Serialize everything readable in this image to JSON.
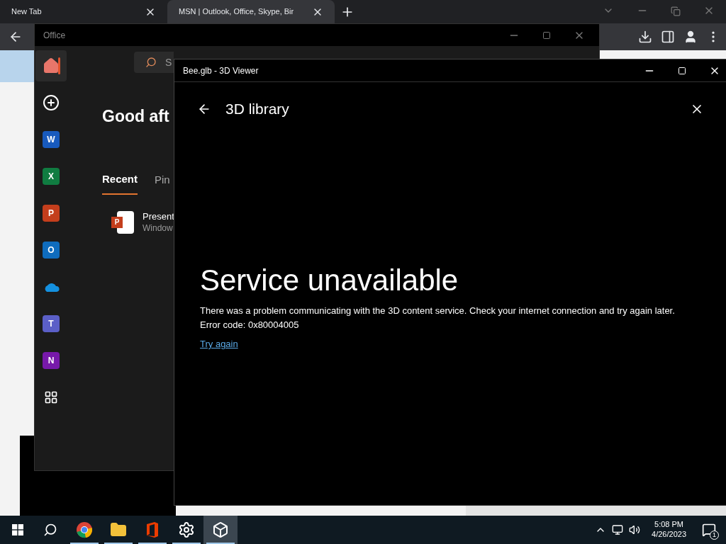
{
  "browser": {
    "tabs": [
      {
        "label": "New Tab",
        "selected": false
      },
      {
        "label": "MSN | Outlook, Office, Skype, Bir",
        "selected": true
      }
    ]
  },
  "office": {
    "title": "Office",
    "search": {
      "placeholder": "S"
    },
    "greeting": "Good aft",
    "sidebar": [
      {
        "kind": "home",
        "selected": true
      },
      {
        "kind": "create",
        "selected": false
      },
      {
        "kind": "app",
        "letter": "W",
        "color": "#185abd",
        "selected": false
      },
      {
        "kind": "app",
        "letter": "X",
        "color": "#107c41",
        "selected": false
      },
      {
        "kind": "app",
        "letter": "P",
        "color": "#c43e1c",
        "selected": false
      },
      {
        "kind": "app",
        "letter": "O",
        "color": "#0f6cbd",
        "selected": false
      },
      {
        "kind": "cloud",
        "selected": false
      },
      {
        "kind": "app",
        "letter": "T",
        "color": "#5b5fc7",
        "selected": false
      },
      {
        "kind": "app",
        "letter": "N",
        "color": "#7719aa",
        "selected": false
      },
      {
        "kind": "more",
        "selected": false
      }
    ],
    "tabs": [
      {
        "label": "Recent",
        "selected": true
      },
      {
        "label": "Pin",
        "selected": false
      }
    ],
    "files": [
      {
        "badge": "P",
        "name": "Present",
        "location": "Window"
      }
    ]
  },
  "viewer": {
    "title": "Bee.glb - 3D Viewer",
    "heading": "3D library",
    "error_title": "Service unavailable",
    "message": "There was a problem communicating with the 3D content service. Check your internet connection and try again later.",
    "error_code": "Error code: 0x80004005",
    "link": "Try again"
  },
  "taskbar": {
    "apps": [
      {
        "kind": "search",
        "running": false,
        "selected": false
      },
      {
        "kind": "chrome",
        "running": true,
        "selected": false
      },
      {
        "kind": "folder",
        "running": true,
        "selected": false
      },
      {
        "kind": "office",
        "running": true,
        "selected": false
      },
      {
        "kind": "settings",
        "running": true,
        "selected": false
      },
      {
        "kind": "cube",
        "running": true,
        "selected": true
      }
    ],
    "time": "5:08 PM",
    "date": "4/26/2023",
    "notifications": "1"
  }
}
